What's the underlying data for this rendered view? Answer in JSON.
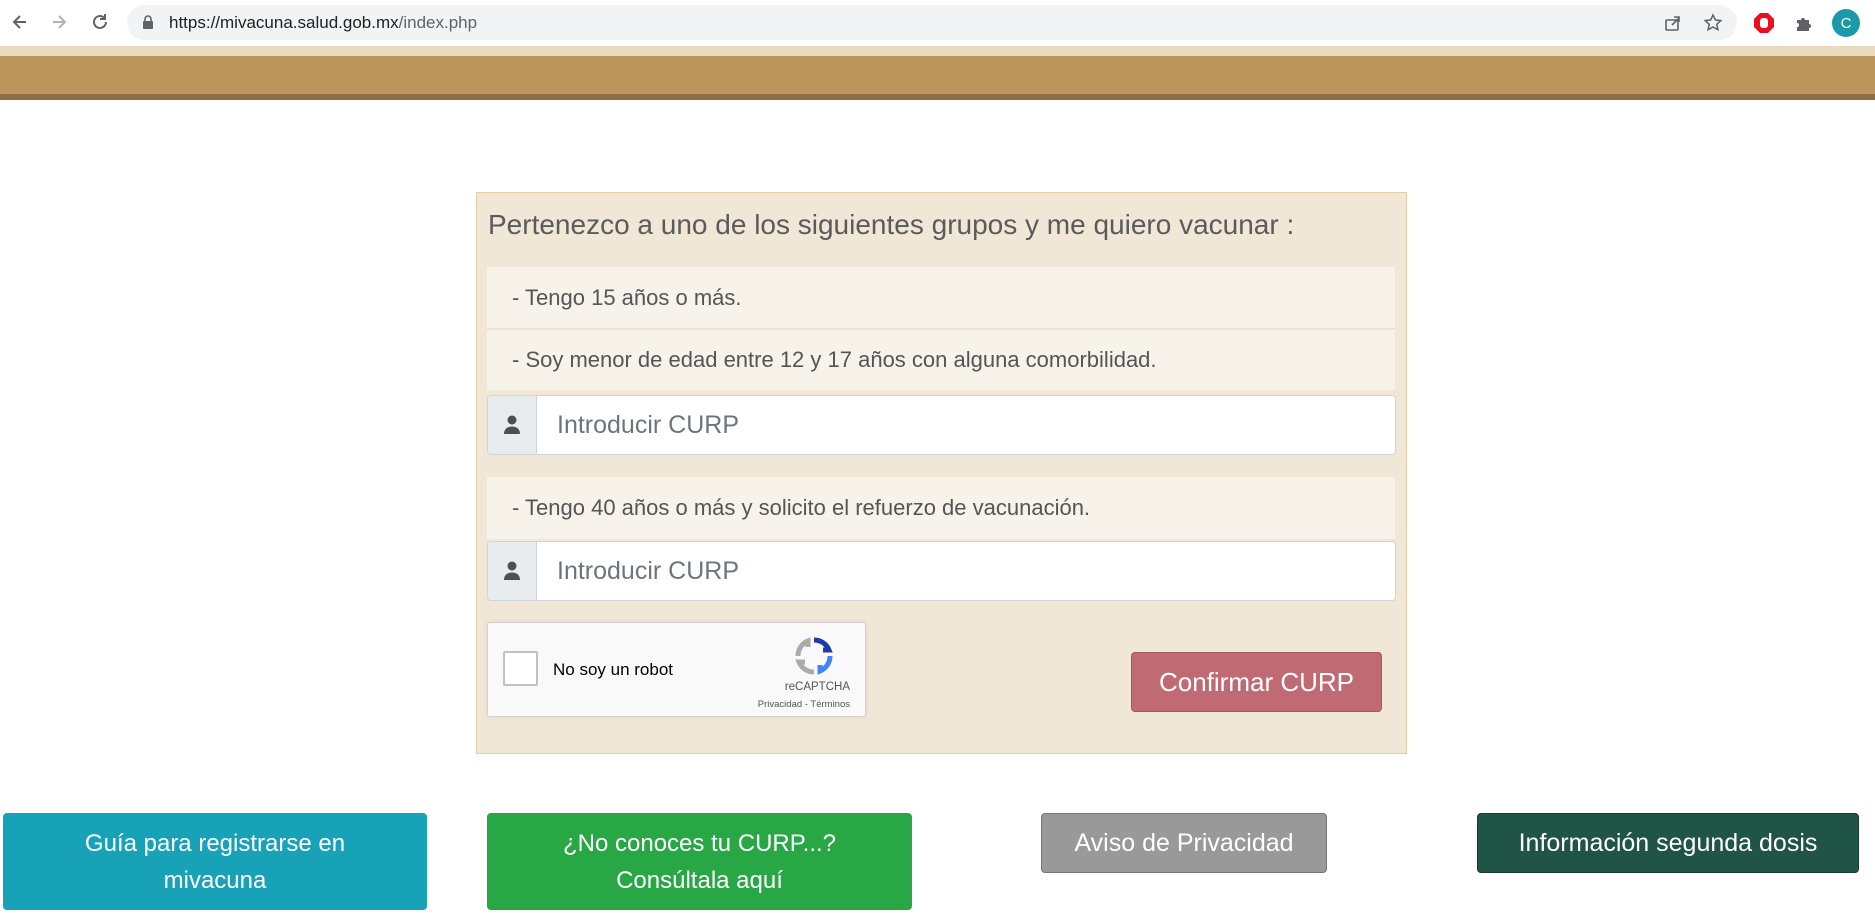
{
  "browser": {
    "url_domain": "https://mivacuna.salud.gob.mx",
    "url_path": "/index.php",
    "profile_initial": "C"
  },
  "card": {
    "title": "Pertenezco a uno de los siguientes grupos y me quiero vacunar :",
    "group_1": "- Tengo 15 años o más.",
    "group_2": "- Soy menor de edad entre 12 y 17 años con alguna comorbilidad.",
    "group_3": "- Tengo 40 años o más y solicito el refuerzo de vacunación.",
    "curp_placeholder_1": "Introducir CURP",
    "curp_placeholder_2": "Introducir CURP",
    "recaptcha": {
      "label": "No soy un robot",
      "brand": "reCAPTCHA",
      "links": "Privacidad - Términos"
    },
    "confirm_label": "Confirmar CURP"
  },
  "footer_buttons": {
    "guide_line1": "Guía para registrarse en",
    "guide_line2": "mivacuna",
    "curp_line1": "¿No conoces tu CURP...?",
    "curp_line2": "Consúltala aquí",
    "privacy": "Aviso de Privacidad",
    "second_dose": "Información segunda dosis"
  },
  "colors": {
    "banner": "#bc955c",
    "card_bg": "#f0e7d6",
    "confirm": "#c06a74",
    "guide": "#17a2b8",
    "curp_help": "#28a745",
    "privacy": "#999999",
    "second_dose": "#1f5447"
  }
}
